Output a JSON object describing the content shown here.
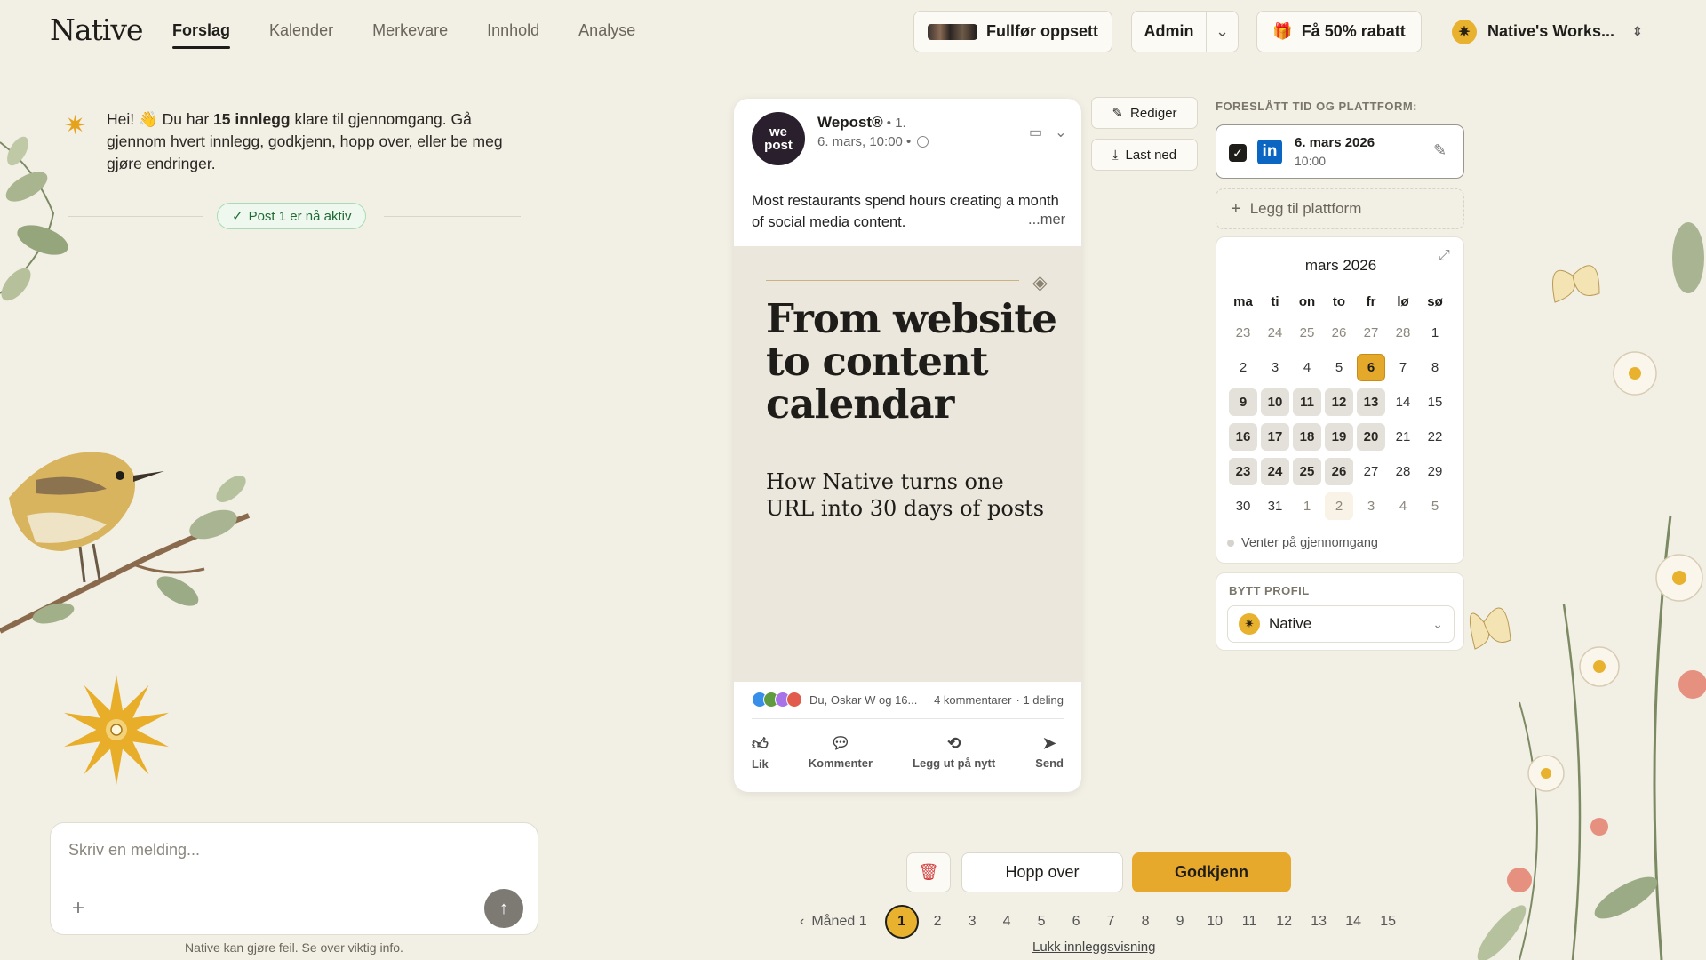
{
  "header": {
    "logo": "Native",
    "tabs": [
      {
        "label": "Forslag",
        "active": true
      },
      {
        "label": "Kalender"
      },
      {
        "label": "Merkevare"
      },
      {
        "label": "Innhold"
      },
      {
        "label": "Analyse"
      }
    ],
    "setup_label": "Fullfør oppsett",
    "admin_label": "Admin",
    "discount_label": "Få 50% rabatt",
    "workspace_label": "Native's Works..."
  },
  "chat": {
    "greeting_pre": "Hei! 👋 Du har ",
    "greeting_bold": "15 innlegg",
    "greeting_post": " klare til gjennomgang. Gå gjennom hvert innlegg, godkjenn, hopp over, eller be meg gjøre endringer.",
    "status_pill": "Post 1 er nå aktiv",
    "input_placeholder": "Skriv en melding...",
    "disclaimer": "Native kan gjøre feil. Se over viktig info."
  },
  "post": {
    "author": "Wepost®",
    "author_suffix": " • 1.",
    "meta": "6. mars, 10:00 •",
    "avatar_top": "we",
    "avatar_bottom": "post",
    "text": "Most restaurants spend hours creating a month of social media content.",
    "more": "...mer",
    "hero_title": "From website to content calendar",
    "hero_subtitle": "How Native turns one URL into 30 days of posts",
    "reactions_text": "Du, Oskar W og 16...",
    "comments": "4 kommentarer",
    "shares": "· 1 deling",
    "actions": {
      "like": "Lik",
      "comment": "Kommenter",
      "repost": "Legg ut på nytt",
      "send": "Send"
    }
  },
  "side_buttons": {
    "edit": "Rediger",
    "download": "Last ned"
  },
  "schedule": {
    "label": "FORESLÅTT TID OG PLATTFORM:",
    "platform": "LinkedIn",
    "date": "6. mars 2026",
    "time": "10:00",
    "add_platform": "Legg til plattform"
  },
  "calendar": {
    "title": "mars 2026",
    "weekdays": [
      "ma",
      "ti",
      "on",
      "to",
      "fr",
      "lø",
      "sø"
    ],
    "legend": "Venter på gjennomgang",
    "weeks": [
      [
        {
          "d": "23",
          "s": "muted"
        },
        {
          "d": "24",
          "s": "muted"
        },
        {
          "d": "25",
          "s": "muted"
        },
        {
          "d": "26",
          "s": "muted"
        },
        {
          "d": "27",
          "s": "muted"
        },
        {
          "d": "28",
          "s": "muted"
        },
        {
          "d": "1",
          "s": ""
        }
      ],
      [
        {
          "d": "2",
          "s": ""
        },
        {
          "d": "3",
          "s": ""
        },
        {
          "d": "4",
          "s": ""
        },
        {
          "d": "5",
          "s": ""
        },
        {
          "d": "6",
          "s": "today"
        },
        {
          "d": "7",
          "s": ""
        },
        {
          "d": "8",
          "s": ""
        }
      ],
      [
        {
          "d": "9",
          "s": "sched"
        },
        {
          "d": "10",
          "s": "sched"
        },
        {
          "d": "11",
          "s": "sched"
        },
        {
          "d": "12",
          "s": "sched"
        },
        {
          "d": "13",
          "s": "sched"
        },
        {
          "d": "14",
          "s": ""
        },
        {
          "d": "15",
          "s": ""
        }
      ],
      [
        {
          "d": "16",
          "s": "sched"
        },
        {
          "d": "17",
          "s": "sched"
        },
        {
          "d": "18",
          "s": "sched"
        },
        {
          "d": "19",
          "s": "sched"
        },
        {
          "d": "20",
          "s": "sched"
        },
        {
          "d": "21",
          "s": ""
        },
        {
          "d": "22",
          "s": ""
        }
      ],
      [
        {
          "d": "23",
          "s": "sched"
        },
        {
          "d": "24",
          "s": "sched"
        },
        {
          "d": "25",
          "s": "sched"
        },
        {
          "d": "26",
          "s": "sched"
        },
        {
          "d": "27",
          "s": ""
        },
        {
          "d": "28",
          "s": ""
        },
        {
          "d": "29",
          "s": ""
        }
      ],
      [
        {
          "d": "30",
          "s": ""
        },
        {
          "d": "31",
          "s": ""
        },
        {
          "d": "1",
          "s": "muted"
        },
        {
          "d": "2",
          "s": "muted soft"
        },
        {
          "d": "3",
          "s": "muted"
        },
        {
          "d": "4",
          "s": "muted"
        },
        {
          "d": "5",
          "s": "muted"
        }
      ]
    ]
  },
  "profile": {
    "label": "BYTT PROFIL",
    "selected": "Native"
  },
  "review": {
    "skip": "Hopp over",
    "approve": "Godkjenn",
    "prev_label": "Måned 1",
    "pages": [
      "1",
      "2",
      "3",
      "4",
      "5",
      "6",
      "7",
      "8",
      "9",
      "10",
      "11",
      "12",
      "13",
      "14",
      "15"
    ],
    "active_page": "1",
    "close_view": "Lukk innleggsvisning"
  },
  "colors": {
    "background": "#f2efe4",
    "accent": "#e7a92b",
    "linkedin": "#0a66c2",
    "success": "#1f6a35",
    "danger": "#d23a3a"
  }
}
